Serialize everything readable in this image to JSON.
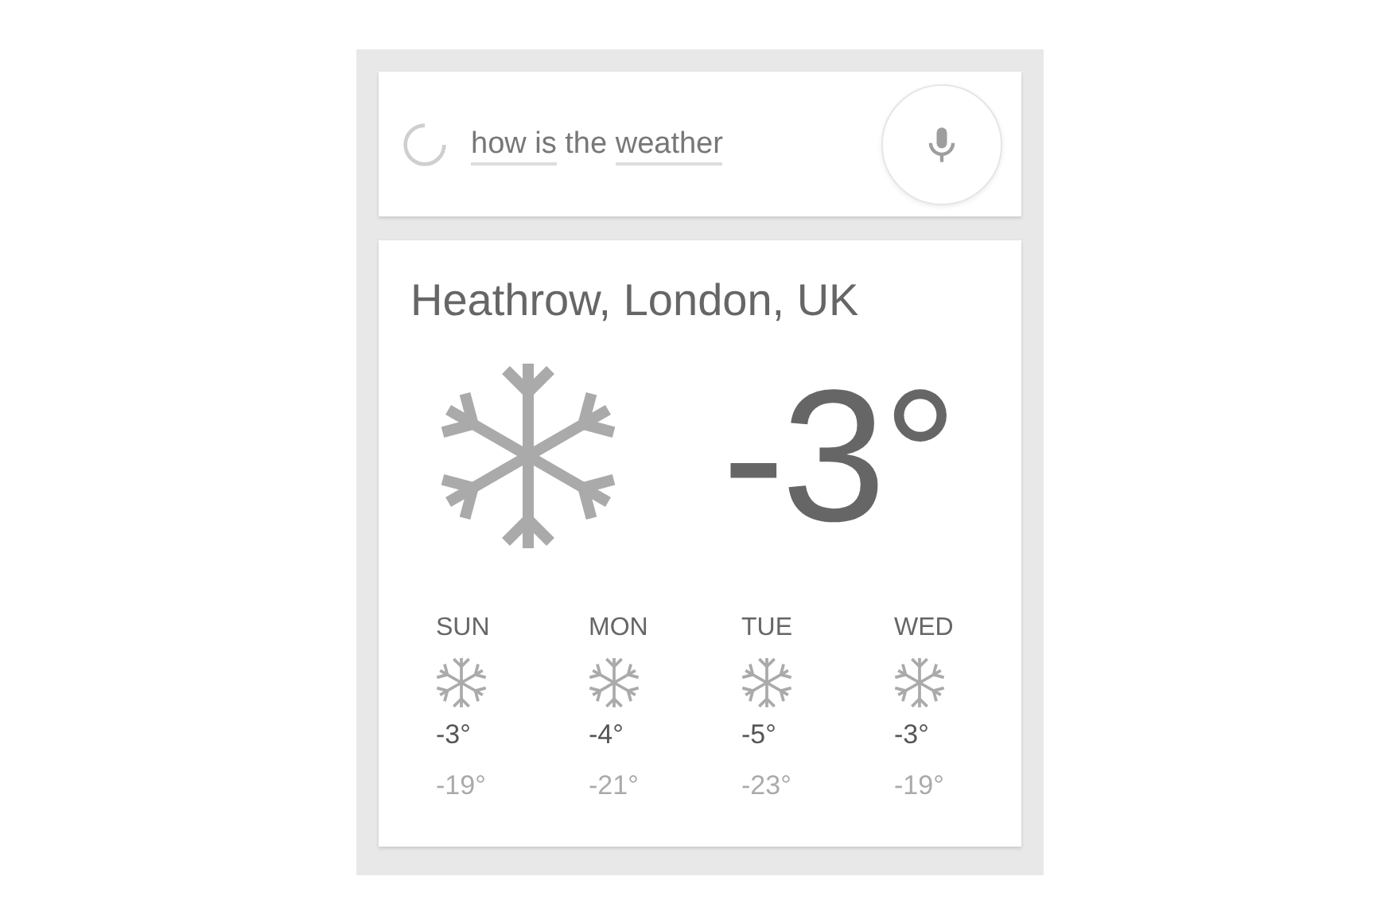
{
  "search": {
    "query": [
      {
        "text": "how is",
        "underlined": true
      },
      {
        "text": "the",
        "underlined": false
      },
      {
        "text": "weather",
        "underlined": true
      }
    ]
  },
  "weather": {
    "location": "Heathrow, London, UK",
    "temperature": "-3°",
    "forecast": [
      {
        "day": "SUN",
        "high": "-3°",
        "low": "-19°"
      },
      {
        "day": "MON",
        "high": "-4°",
        "low": "-21°"
      },
      {
        "day": "TUE",
        "high": "-5°",
        "low": "-23°"
      },
      {
        "day": "WED",
        "high": "-3°",
        "low": "-19°"
      }
    ]
  }
}
